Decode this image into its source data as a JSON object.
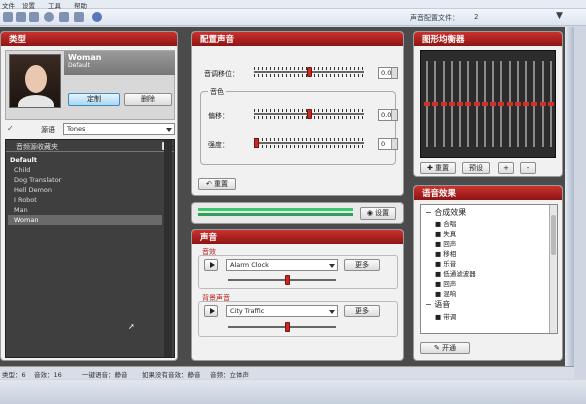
{
  "menu": {
    "items": [
      "文件",
      "设置",
      "工具",
      "帮助"
    ]
  },
  "toolbar": {
    "config_label": "声音配置文件：",
    "config_value": "2"
  },
  "type_panel": {
    "title": "类型",
    "voice_name": "Woman",
    "voice_sub": "Default",
    "custom_btn": "定制",
    "delete_btn": "删除",
    "source_label": "源语",
    "source_value": "Tones",
    "list_header": "音频源收藏夹",
    "group": "Default",
    "items": [
      "Child",
      "Dog Translator",
      "Hell Demon",
      "I Robot",
      "Man",
      "Woman"
    ]
  },
  "config_panel": {
    "title": "配置声音",
    "pitch_label": "音调移位：",
    "pitch_value": "0.00",
    "pitch_level": 0.5,
    "timbre_group": "音色",
    "offset_label": "偏移：",
    "offset_value": "0.00",
    "offset_level": 0.5,
    "strength_label": "强度：",
    "strength_value": "0",
    "strength_level": 0.0,
    "reset_btn": "重置"
  },
  "level_panel": {
    "settings_btn": "设置"
  },
  "sound_panel": {
    "title": "声音",
    "effect_label": "音效",
    "effect_value": "Alarm Clock",
    "more1": "更多",
    "effect_level": 0.55,
    "bg_label": "背景声音",
    "bg_value": "City Traffic",
    "more2": "更多",
    "bg_level": 0.55
  },
  "eq_panel": {
    "title": "图形均衡器",
    "reset_btn": "重置",
    "preset_btn": "预设",
    "add_btn": "+",
    "remove_btn": "-",
    "bands": [
      0.5,
      0.5,
      0.5,
      0.5,
      0.5,
      0.5,
      0.5,
      0.5,
      0.5,
      0.5,
      0.5,
      0.5,
      0.5,
      0.5,
      0.5,
      0.5
    ]
  },
  "fx_panel": {
    "title": "语音效果",
    "group1": "合成效果",
    "items1": [
      "合唱",
      "失真",
      "回声",
      "移相",
      "乐音",
      "低通滤波器",
      "回声",
      "混响"
    ],
    "group2": "语音",
    "items2": [
      "带调"
    ],
    "open_btn": "开通"
  },
  "status": {
    "t1": "类型：6",
    "t2": "音效：16",
    "t3": "一键语音：静音",
    "t4": "如果没有音效：静音",
    "t5": "音频：立体声"
  },
  "colors": {
    "accent": "#b21f1c",
    "panel": "#f1f1f1",
    "app_bg": "#4b4b4b"
  }
}
